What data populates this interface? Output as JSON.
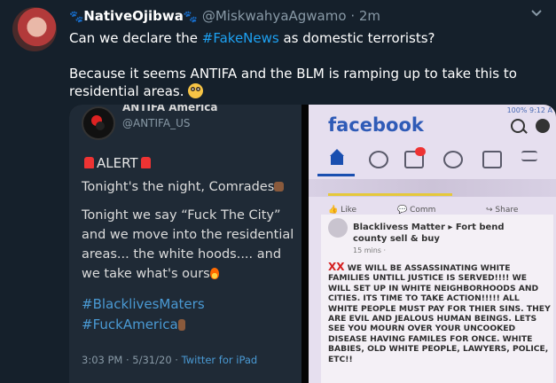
{
  "tweet": {
    "display_name": "NativeOjibwa",
    "handle": "@MiskwahyaAgwamo",
    "separator": "·",
    "time": "2m",
    "text_before_tag": "Can we declare the ",
    "hashtag": "#FakeNews",
    "text_after_tag": " as domestic terrorists?",
    "text_second": "Because it seems ANTIFA and the BLM is ramping up to take this to residential areas.",
    "emoji": "flushed-face"
  },
  "media_left": {
    "account_name": "ANTIFA America",
    "account_handle": "@ANTIFA_US",
    "alert_label": "ALERT",
    "lines": [
      "Tonight's the night, Comrades",
      "Tonight we say “Fuck The City” and we move into the residential areas... the white hoods.... and we take what's ours"
    ],
    "hashtags": [
      "#BlacklivesMaters",
      "#FuckAmerica"
    ],
    "timestamp": "3:03 PM · 5/31/20 · ",
    "source": "Twitter for iPad"
  },
  "media_right": {
    "status": "100% 9:12 A",
    "logo": "facebook",
    "like_label": "Like",
    "comment_label": "Comm",
    "share_label": "Share",
    "group_line1": "Blacklivess Matter ▸ Fort bend",
    "group_line2": "county sell  & buy",
    "post_time": "15 mins · ",
    "xx": "XX",
    "post_text": "WE WILL BE ASSASSINATING WHITE FAMILIES UNTILL JUSTICE IS SERVED!!!! WE WILL SET UP IN WHITE NEIGHBORHOODS AND CITIES. ITS TIME TO TAKE ACTION!!!!! ALL WHITE PEOPLE MUST PAY FOR THIER SINS. THEY ARE EVIL AND JEALOUS HUMAN BEINGS. LETS SEE YOU MOURN OVER YOUR UNCOOKED DISEASE HAVING FAMILES FOR ONCE. WHITE BABIES, OLD WHITE PEOPLE, LAWYERS, POLICE, ETC!!"
  },
  "colors": {
    "background": "#15202b",
    "accent": "#1da1f2",
    "muted": "#8899a6"
  }
}
